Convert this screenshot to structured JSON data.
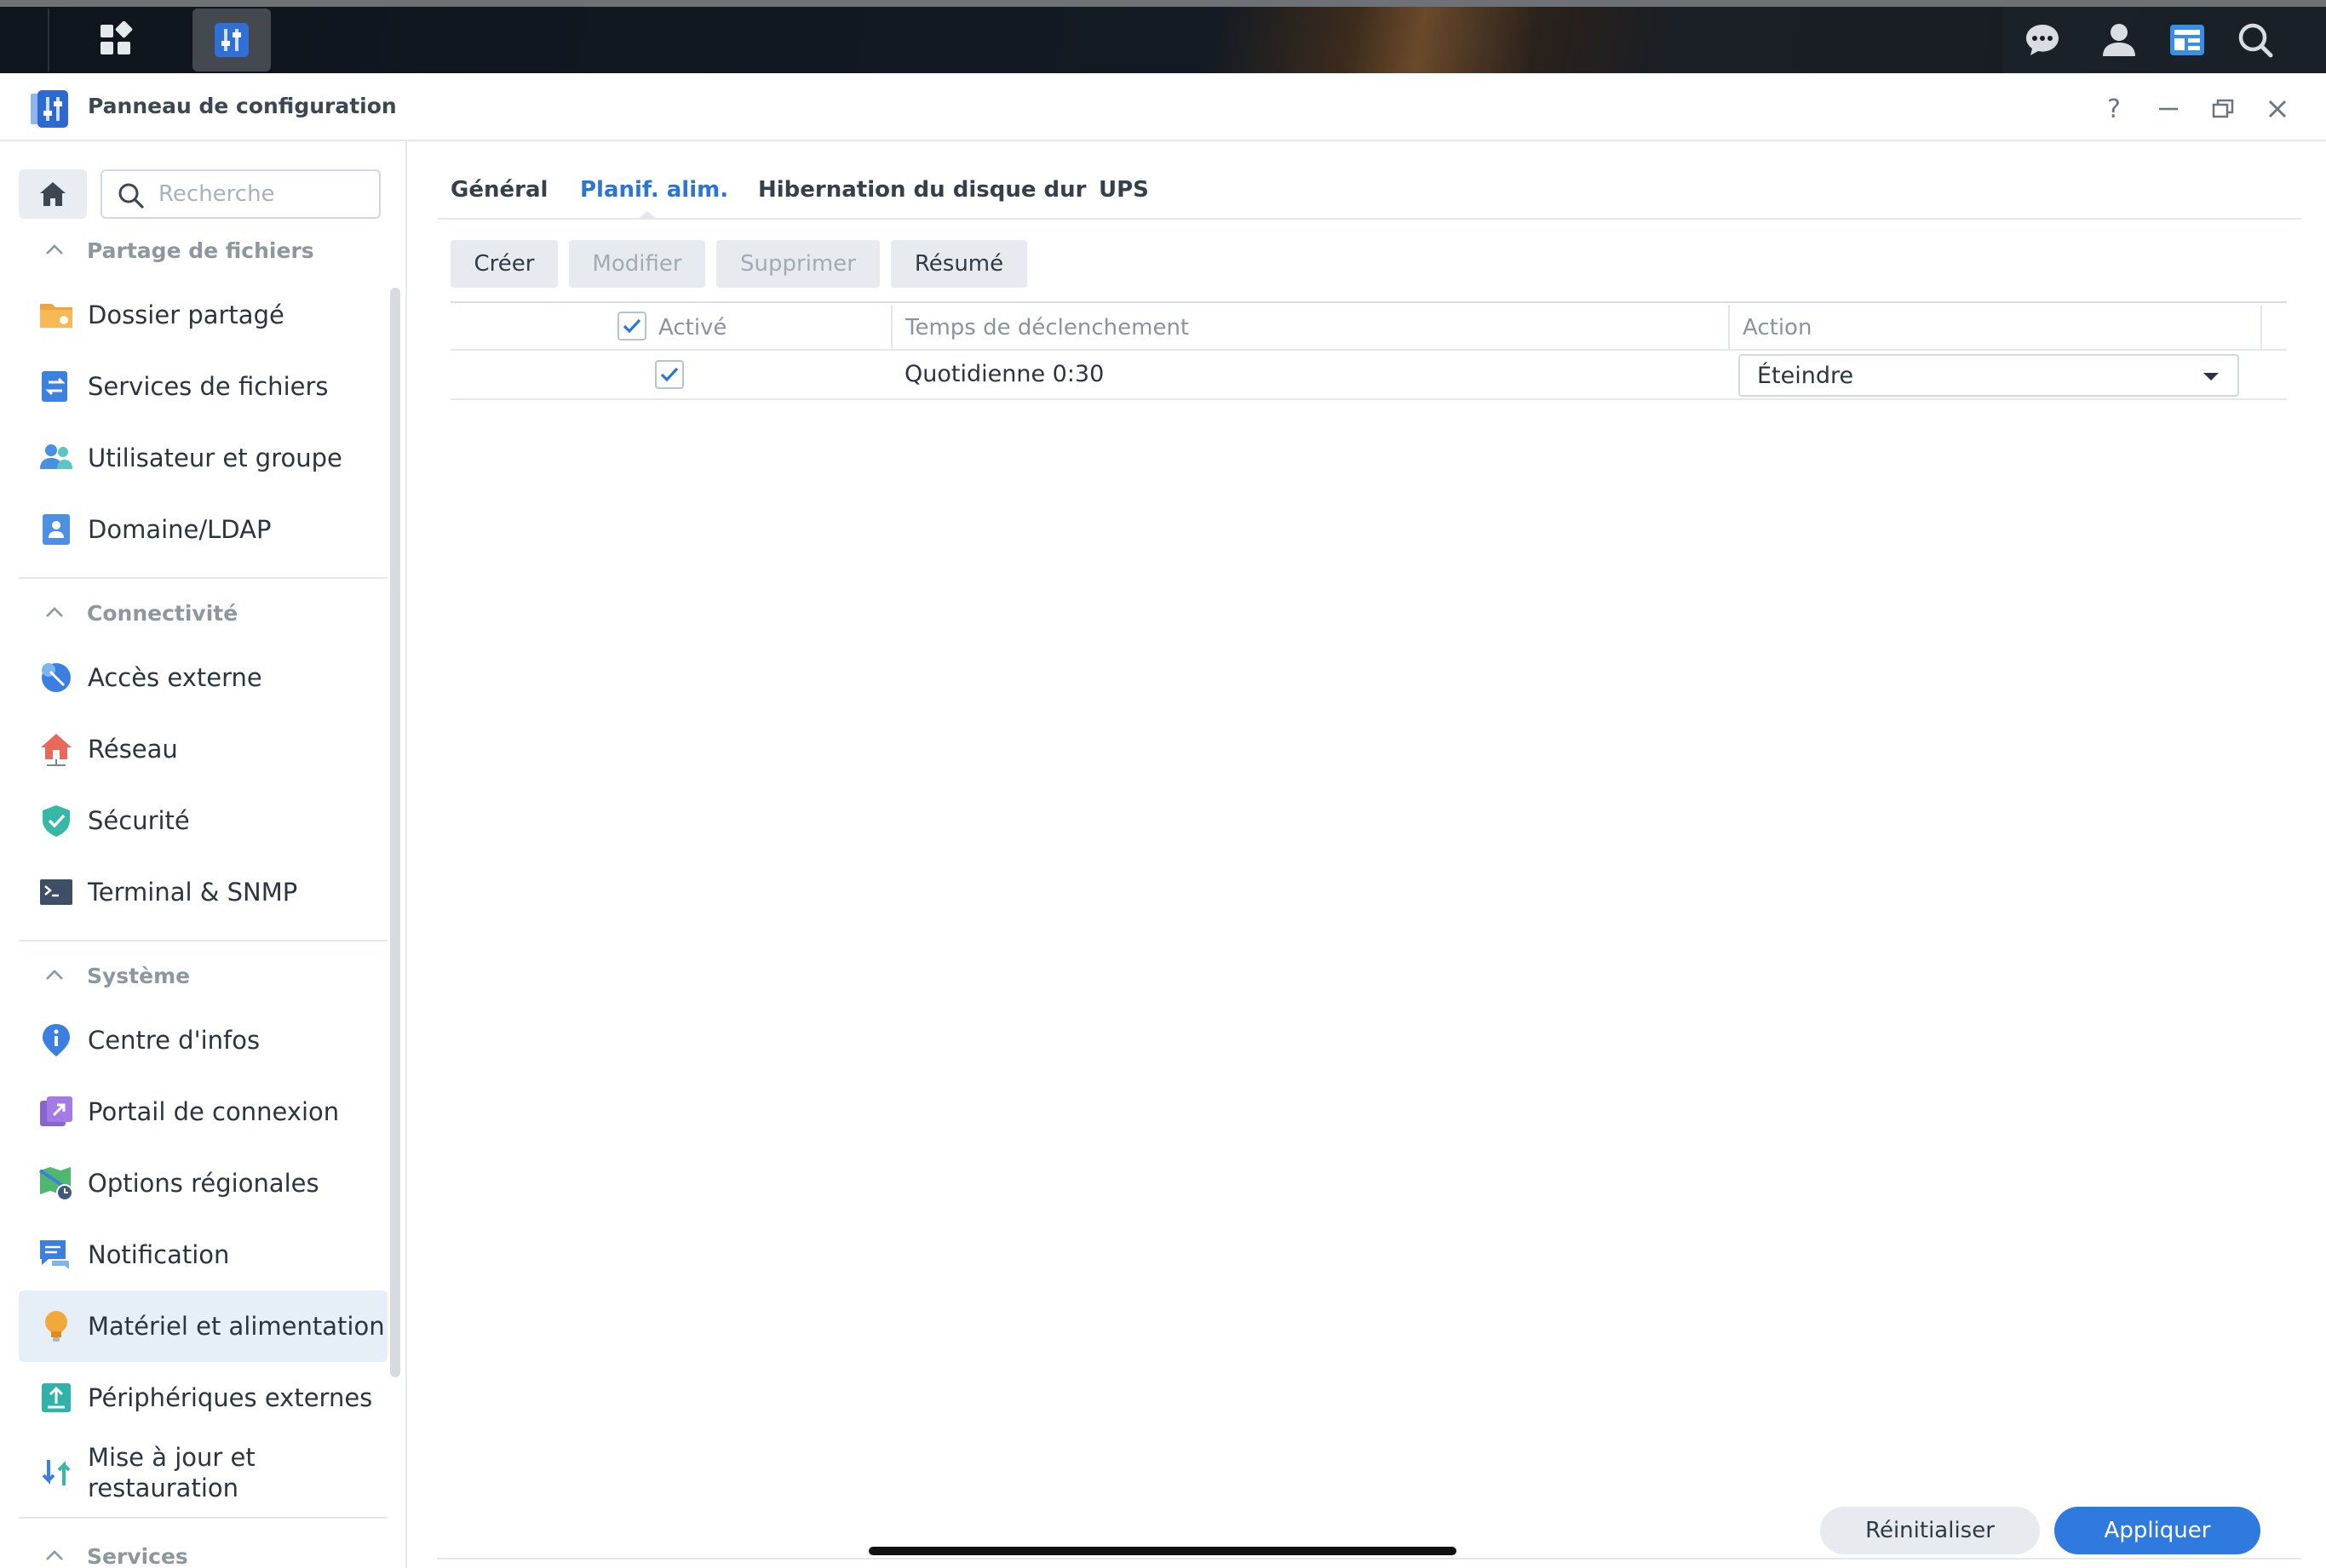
{
  "window": {
    "title": "Panneau de configuration"
  },
  "window_controls": {
    "help": "?"
  },
  "search": {
    "placeholder": "Recherche"
  },
  "sidebar": {
    "sections": [
      {
        "title": "Partage de fichiers",
        "items": [
          "Dossier partagé",
          "Services de fichiers",
          "Utilisateur et groupe",
          "Domaine/LDAP"
        ]
      },
      {
        "title": "Connectivité",
        "items": [
          "Accès externe",
          "Réseau",
          "Sécurité",
          "Terminal & SNMP"
        ]
      },
      {
        "title": "Système",
        "items": [
          "Centre d'infos",
          "Portail de connexion",
          "Options régionales",
          "Notification",
          "Matériel et alimentation",
          "Périphériques externes",
          "Mise à jour et restauration"
        ]
      },
      {
        "title": "Services",
        "items": []
      }
    ],
    "selected": "Matériel et alimentation"
  },
  "tabs": [
    "Général",
    "Planif. alim.",
    "Hibernation du disque dur",
    "UPS"
  ],
  "active_tab": "Planif. alim.",
  "toolbar": {
    "create": "Créer",
    "modify": "Modifier",
    "delete": "Supprimer",
    "summary": "Résumé"
  },
  "table": {
    "columns": [
      "Activé",
      "Temps de déclenchement",
      "Action"
    ],
    "rows": [
      {
        "enabled": true,
        "trigger": "Quotidienne 0:30",
        "action": "Éteindre"
      }
    ]
  },
  "footer": {
    "reset": "Réinitialiser",
    "apply": "Appliquer"
  },
  "colors": {
    "accent": "#2f7ade",
    "selected_bg": "#e6eef7"
  }
}
